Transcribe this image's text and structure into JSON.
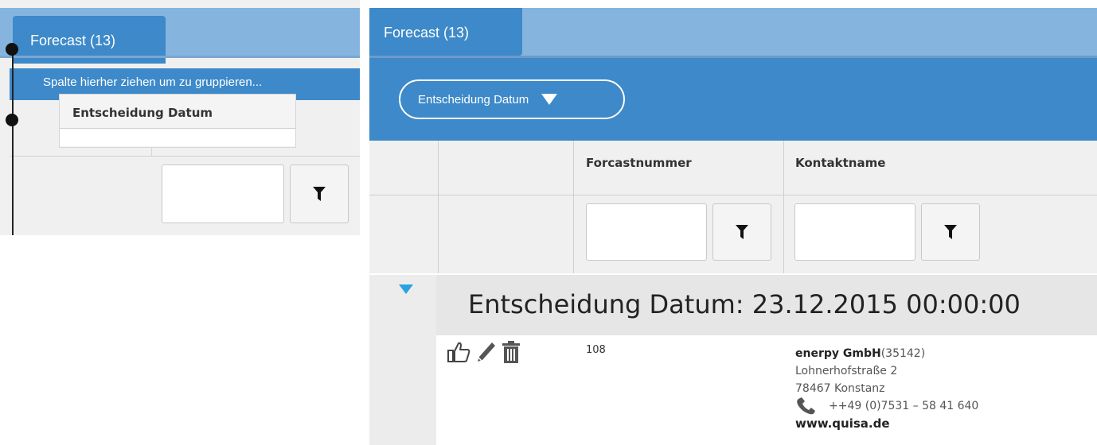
{
  "left_panel": {
    "tab_label": "Forecast (13)",
    "group_hint": "Spalte hierher ziehen um zu gruppieren...",
    "drag_column": "Entscheidung Datum"
  },
  "grid": {
    "tab_label": "Forecast (13)",
    "group_chip": "Entscheidung Datum",
    "columns": [
      "Forcastnummer",
      "Kontaktname"
    ],
    "group_title": "Entscheidung Datum: 23.12.2015 00:00:00"
  },
  "row": {
    "forecast_number": "108",
    "contact": {
      "company": "enerpy GmbH",
      "id": "(35142)",
      "street": "Lohnerhofstraße 2",
      "city": "78467 Konstanz",
      "phone": "++49 (0)7531 – 58 41 640",
      "website": "www.quisa.de"
    }
  },
  "icons": [
    "thumbs-up-icon",
    "pencil-icon",
    "trash-icon",
    "phone-icon",
    "filter-icon",
    "chevron-down-icon",
    "expand-icon"
  ],
  "colors": {
    "accent_blue": "#3d89c9",
    "tab_bar": "#85b4df",
    "expand": "#29a3e0"
  }
}
